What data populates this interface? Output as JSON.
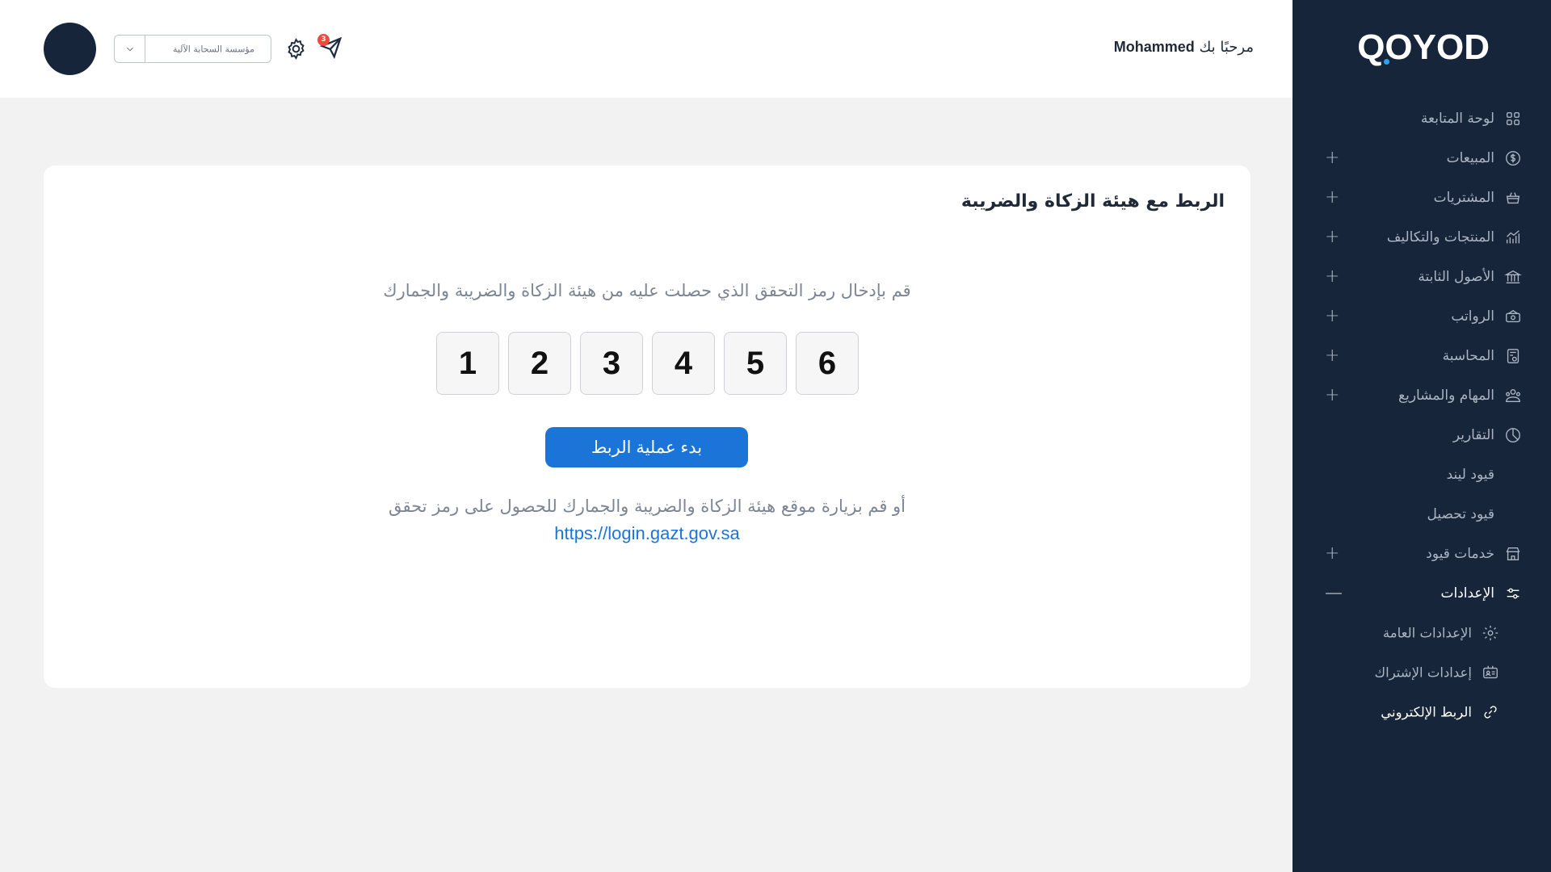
{
  "brand": {
    "logo_text": "QOYOD"
  },
  "header": {
    "greeting_prefix": "مرحبًا بك",
    "user_name": "Mohammed",
    "organization": "مؤسسة السحابة الآلية",
    "notification_count": "3"
  },
  "sidebar": {
    "items": [
      {
        "label": "لوحة المتابعة",
        "icon": "dashboard-grid-icon",
        "expandable": false
      },
      {
        "label": "المبيعات",
        "icon": "dollar-circle-icon",
        "expandable": true
      },
      {
        "label": "المشتريات",
        "icon": "shopping-basket-icon",
        "expandable": true
      },
      {
        "label": "المنتجات والتكاليف",
        "icon": "growth-chart-icon",
        "expandable": true
      },
      {
        "label": "الأصول الثابتة",
        "icon": "institution-icon",
        "expandable": true
      },
      {
        "label": "الرواتب",
        "icon": "cash-icon",
        "expandable": true
      },
      {
        "label": "المحاسبة",
        "icon": "accounting-document-icon",
        "expandable": true
      },
      {
        "label": "المهام والمشاريع",
        "icon": "team-icon",
        "expandable": true
      },
      {
        "label": "التقارير",
        "icon": "pie-chart-icon",
        "expandable": false
      },
      {
        "label": "قيود ليند",
        "icon": "",
        "expandable": false
      },
      {
        "label": "قيود تحصيل",
        "icon": "",
        "expandable": false
      },
      {
        "label": "خدمات قيود",
        "icon": "store-icon",
        "expandable": true
      },
      {
        "label": "الإعدادات",
        "icon": "sliders-icon",
        "expandable": true,
        "expanded": true
      }
    ],
    "settings_submenu": [
      {
        "label": "الإعدادات العامة",
        "icon": "gear-icon"
      },
      {
        "label": "إعدادات الإشتراك",
        "icon": "id-card-icon"
      },
      {
        "label": "الربط الإلكتروني",
        "icon": "link-icon",
        "current": true
      }
    ]
  },
  "main": {
    "title": "الربط مع هيئة الزكاة والضريبة",
    "instruction": "قم بإدخال رمز التحقق الذي حصلت عليه من هيئة الزكاة والضريبة والجمارك",
    "otp_digits": [
      "1",
      "2",
      "3",
      "4",
      "5",
      "6"
    ],
    "connect_button": "بدء عملية الربط",
    "alt_text": "أو قم بزيارة موقع هيئة الزكاة والضريبة والجمارك للحصول على رمز تحقق",
    "portal_link": "https://login.gazt.gov.sa"
  },
  "colors": {
    "sidebar_bg": "#162539",
    "primary": "#1b75d9",
    "badge": "#ef4a3a",
    "page_bg": "#f2f2f2"
  }
}
